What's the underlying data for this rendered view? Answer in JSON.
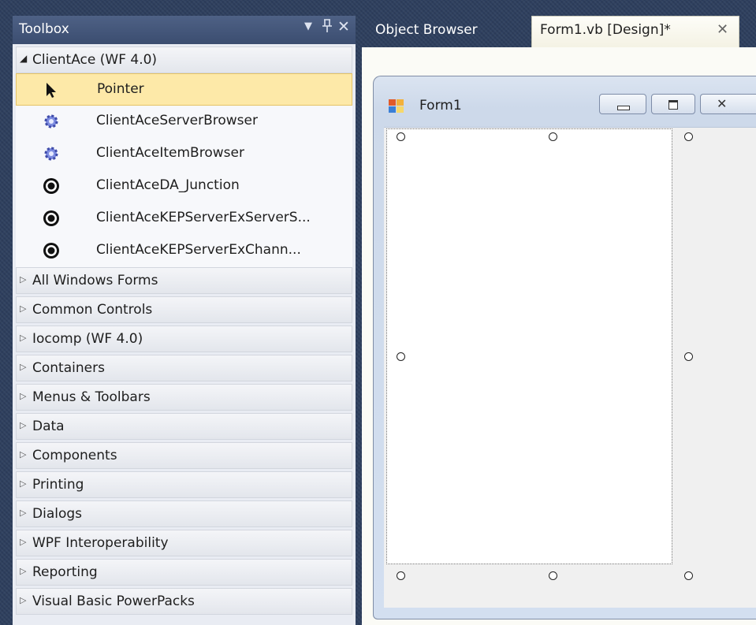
{
  "toolbox": {
    "title": "Toolbox",
    "dropdown_icon": "dropdown-arrow-icon",
    "pin_icon": "pin-icon",
    "close_icon": "close-icon",
    "expanded_group": {
      "label": "ClientAce (WF 4.0)",
      "items": [
        {
          "label": "Pointer",
          "icon": "pointer-icon",
          "selected": true
        },
        {
          "label": "ClientAceServerBrowser",
          "icon": "gear-icon"
        },
        {
          "label": "ClientAceItemBrowser",
          "icon": "gear-icon"
        },
        {
          "label": "ClientAceDA_Junction",
          "icon": "clientace-icon"
        },
        {
          "label": "ClientAceKEPServerExServerS...",
          "icon": "clientace-icon"
        },
        {
          "label": "ClientAceKEPServerExChann...",
          "icon": "clientace-icon"
        }
      ]
    },
    "groups": [
      "All Windows Forms",
      "Common Controls",
      "Iocomp (WF 4.0)",
      "Containers",
      "Menus & Toolbars",
      "Data",
      "Components",
      "Printing",
      "Dialogs",
      "WPF Interoperability",
      "Reporting",
      "Visual Basic PowerPacks"
    ]
  },
  "tabs": [
    {
      "label": "Object Browser",
      "active": false
    },
    {
      "label": "Form1.vb [Design]*",
      "active": true
    }
  ],
  "designer": {
    "form_title": "Form1",
    "form_icon": "form-icon",
    "window_buttons": [
      "minimize-icon",
      "maximize-icon",
      "close-icon"
    ]
  },
  "colors": {
    "header_bg": "#3b4d70",
    "selected_item_bg": "#fde9a8",
    "form_frame": "#d3dff0"
  }
}
